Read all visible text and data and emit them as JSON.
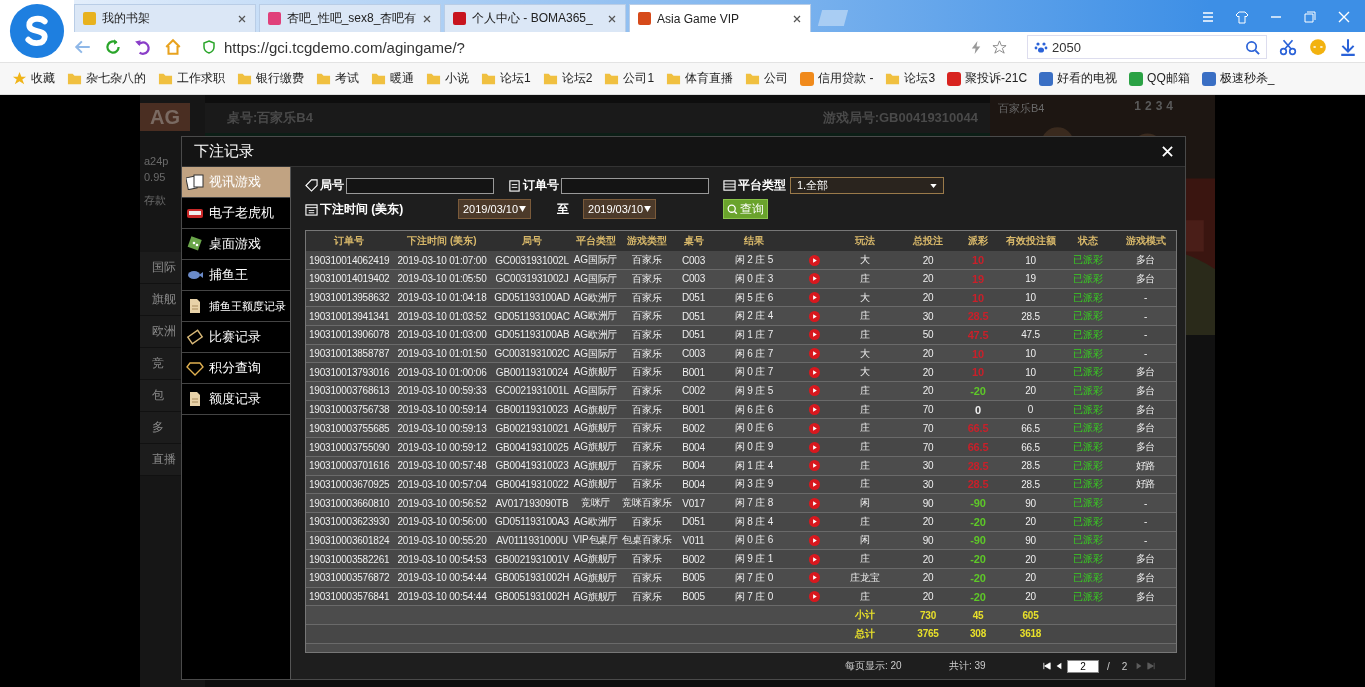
{
  "browser": {
    "tabs": [
      {
        "title": "我的书架",
        "kind": "book",
        "selected": false
      },
      {
        "title": "杏吧_性吧_sex8_杏吧有",
        "kind": "pink",
        "selected": false
      },
      {
        "title": "个人中心 - BOMA365_",
        "kind": "gear",
        "selected": false
      },
      {
        "title": "Asia Game VIP",
        "kind": "ag",
        "selected": true
      }
    ],
    "url": "https://gci.tcgdemo.com/agingame/?",
    "search_text": "2050",
    "bookmarks": [
      {
        "label": "收藏",
        "kind": "star"
      },
      {
        "label": "杂七杂八的",
        "kind": "folder"
      },
      {
        "label": "工作求职",
        "kind": "folder"
      },
      {
        "label": "银行缴费",
        "kind": "folder"
      },
      {
        "label": "考试",
        "kind": "folder"
      },
      {
        "label": "暖通",
        "kind": "folder"
      },
      {
        "label": "小说",
        "kind": "folder"
      },
      {
        "label": "论坛1",
        "kind": "folder"
      },
      {
        "label": "论坛2",
        "kind": "folder"
      },
      {
        "label": "公司1",
        "kind": "folder"
      },
      {
        "label": "体育直播",
        "kind": "folder"
      },
      {
        "label": "公司",
        "kind": "folder"
      },
      {
        "label": "信用贷款 -",
        "kind": "site",
        "color": "#f08a1c"
      },
      {
        "label": "论坛3",
        "kind": "folder"
      },
      {
        "label": "聚投诉-21C",
        "kind": "site",
        "color": "#d8231f"
      },
      {
        "label": "好看的电视",
        "kind": "site",
        "color": "#3a6fc4"
      },
      {
        "label": "QQ邮箱",
        "kind": "site",
        "color": "#2ba245"
      },
      {
        "label": "极速秒杀_",
        "kind": "site",
        "color": "#3a6fc4"
      }
    ]
  },
  "game": {
    "logo": "AG",
    "user": "a24p",
    "balance": "0.95",
    "deposit": "存款",
    "nav": [
      "国际",
      "旗舰",
      "欧洲",
      "竞",
      "包",
      "多",
      "直播"
    ],
    "table_title": "桌号:百家乐B4",
    "round": "游戏局号:GB00419310044",
    "video_title": "百家乐B4",
    "video_tabs": [
      "1",
      "2",
      "3",
      "4"
    ]
  },
  "modal": {
    "title": "下注记录",
    "sidebar": [
      {
        "label": "视讯游戏",
        "kind": "cards",
        "selected": true
      },
      {
        "label": "电子老虎机",
        "kind": "slot",
        "selected": false
      },
      {
        "label": "桌面游戏",
        "kind": "dice",
        "selected": false
      },
      {
        "label": "捕鱼王",
        "kind": "fish",
        "selected": false
      },
      {
        "label": "捕鱼王额度记录",
        "kind": "doc",
        "selected": false
      },
      {
        "label": "比赛记录",
        "kind": "ticket",
        "selected": false
      },
      {
        "label": "积分查询",
        "kind": "diamond",
        "selected": false
      },
      {
        "label": "额度记录",
        "kind": "doc",
        "selected": false
      }
    ],
    "filters": {
      "round_label": "局号",
      "order_label": "订单号",
      "platform_label": "平台类型",
      "platform_value": "1.全部",
      "time_label": "下注时间 (美东)",
      "date_from": "2019/03/10",
      "to_label": "至",
      "date_to": "2019/03/10",
      "query": "查询"
    },
    "table": {
      "columns": [
        "订单号",
        "下注时间 (美东)",
        "局号",
        "平台类型",
        "游戏类型",
        "桌号",
        "结果",
        "",
        "玩法",
        "总投注",
        "派彩",
        "有效投注额",
        "状态",
        "游戏模式"
      ],
      "rows": [
        {
          "id": "190310014062419",
          "time": "2019-03-10 01:07:00",
          "round": "GC0031931002L",
          "platform": "AG国际厅",
          "game": "百家乐",
          "table": "C003",
          "result": "闲 2 庄 5",
          "play": "大",
          "bet": "20",
          "payout": "10",
          "color": "#c8202a",
          "valid": "10",
          "status": "已派彩",
          "mode": "多台"
        },
        {
          "id": "190310014019402",
          "time": "2019-03-10 01:05:50",
          "round": "GC0031931002J",
          "platform": "AG国际厅",
          "game": "百家乐",
          "table": "C003",
          "result": "闲 0 庄 3",
          "play": "庄",
          "bet": "20",
          "payout": "19",
          "color": "#c8202a",
          "valid": "19",
          "status": "已派彩",
          "mode": "多台"
        },
        {
          "id": "190310013958632",
          "time": "2019-03-10 01:04:18",
          "round": "GD051193100AD",
          "platform": "AG欧洲厅",
          "game": "百家乐",
          "table": "D051",
          "result": "闲 5 庄 6",
          "play": "大",
          "bet": "20",
          "payout": "10",
          "color": "#c8202a",
          "valid": "10",
          "status": "已派彩",
          "mode": "-"
        },
        {
          "id": "190310013941341",
          "time": "2019-03-10 01:03:52",
          "round": "GD051193100AC",
          "platform": "AG欧洲厅",
          "game": "百家乐",
          "table": "D051",
          "result": "闲 2 庄 4",
          "play": "庄",
          "bet": "30",
          "payout": "28.5",
          "color": "#c8202a",
          "valid": "28.5",
          "status": "已派彩",
          "mode": "-"
        },
        {
          "id": "190310013906078",
          "time": "2019-03-10 01:03:00",
          "round": "GD051193100AB",
          "platform": "AG欧洲厅",
          "game": "百家乐",
          "table": "D051",
          "result": "闲 1 庄 7",
          "play": "庄",
          "bet": "50",
          "payout": "47.5",
          "color": "#c8202a",
          "valid": "47.5",
          "status": "已派彩",
          "mode": "-"
        },
        {
          "id": "190310013858787",
          "time": "2019-03-10 01:01:50",
          "round": "GC0031931002C",
          "platform": "AG国际厅",
          "game": "百家乐",
          "table": "C003",
          "result": "闲 6 庄 7",
          "play": "大",
          "bet": "20",
          "payout": "10",
          "color": "#c8202a",
          "valid": "10",
          "status": "已派彩",
          "mode": "-"
        },
        {
          "id": "190310013793016",
          "time": "2019-03-10 01:00:06",
          "round": "GB00119310024",
          "platform": "AG旗舰厅",
          "game": "百家乐",
          "table": "B001",
          "result": "闲 0 庄 7",
          "play": "大",
          "bet": "20",
          "payout": "10",
          "color": "#c8202a",
          "valid": "10",
          "status": "已派彩",
          "mode": "多台"
        },
        {
          "id": "190310003768613",
          "time": "2019-03-10 00:59:33",
          "round": "GC0021931001L",
          "platform": "AG国际厅",
          "game": "百家乐",
          "table": "C002",
          "result": "闲 9 庄 5",
          "play": "庄",
          "bet": "20",
          "payout": "-20",
          "color": "#5ec828",
          "valid": "20",
          "status": "已派彩",
          "mode": "多台"
        },
        {
          "id": "190310003756738",
          "time": "2019-03-10 00:59:14",
          "round": "GB00119310023",
          "platform": "AG旗舰厅",
          "game": "百家乐",
          "table": "B001",
          "result": "闲 6 庄 6",
          "play": "庄",
          "bet": "70",
          "payout": "0",
          "color": "#eeeeee",
          "valid": "0",
          "status": "已派彩",
          "mode": "多台"
        },
        {
          "id": "190310003755685",
          "time": "2019-03-10 00:59:13",
          "round": "GB00219310021",
          "platform": "AG旗舰厅",
          "game": "百家乐",
          "table": "B002",
          "result": "闲 0 庄 6",
          "play": "庄",
          "bet": "70",
          "payout": "66.5",
          "color": "#c8202a",
          "valid": "66.5",
          "status": "已派彩",
          "mode": "多台"
        },
        {
          "id": "190310003755090",
          "time": "2019-03-10 00:59:12",
          "round": "GB00419310025",
          "platform": "AG旗舰厅",
          "game": "百家乐",
          "table": "B004",
          "result": "闲 0 庄 9",
          "play": "庄",
          "bet": "70",
          "payout": "66.5",
          "color": "#c8202a",
          "valid": "66.5",
          "status": "已派彩",
          "mode": "多台"
        },
        {
          "id": "190310003701616",
          "time": "2019-03-10 00:57:48",
          "round": "GB00419310023",
          "platform": "AG旗舰厅",
          "game": "百家乐",
          "table": "B004",
          "result": "闲 1 庄 4",
          "play": "庄",
          "bet": "30",
          "payout": "28.5",
          "color": "#c8202a",
          "valid": "28.5",
          "status": "已派彩",
          "mode": "好路"
        },
        {
          "id": "190310003670925",
          "time": "2019-03-10 00:57:04",
          "round": "GB00419310022",
          "platform": "AG旗舰厅",
          "game": "百家乐",
          "table": "B004",
          "result": "闲 3 庄 9",
          "play": "庄",
          "bet": "30",
          "payout": "28.5",
          "color": "#c8202a",
          "valid": "28.5",
          "status": "已派彩",
          "mode": "好路"
        },
        {
          "id": "190310003660810",
          "time": "2019-03-10 00:56:52",
          "round": "AV017193090TB",
          "platform": "竞咪厅",
          "game": "竞咪百家乐",
          "table": "V017",
          "result": "闲 7 庄 8",
          "play": "闲",
          "bet": "90",
          "payout": "-90",
          "color": "#5ec828",
          "valid": "90",
          "status": "已派彩",
          "mode": "-"
        },
        {
          "id": "190310003623930",
          "time": "2019-03-10 00:56:00",
          "round": "GD051193100A3",
          "platform": "AG欧洲厅",
          "game": "百家乐",
          "table": "D051",
          "result": "闲 8 庄 4",
          "play": "庄",
          "bet": "20",
          "payout": "-20",
          "color": "#5ec828",
          "valid": "20",
          "status": "已派彩",
          "mode": "-"
        },
        {
          "id": "190310003601824",
          "time": "2019-03-10 00:55:20",
          "round": "AV0111931000U",
          "platform": "VIP包桌厅",
          "game": "包桌百家乐",
          "table": "V011",
          "result": "闲 0 庄 6",
          "play": "闲",
          "bet": "90",
          "payout": "-90",
          "color": "#5ec828",
          "valid": "90",
          "status": "已派彩",
          "mode": "-"
        },
        {
          "id": "190310003582261",
          "time": "2019-03-10 00:54:53",
          "round": "GB0021931001V",
          "platform": "AG旗舰厅",
          "game": "百家乐",
          "table": "B002",
          "result": "闲 9 庄 1",
          "play": "庄",
          "bet": "20",
          "payout": "-20",
          "color": "#5ec828",
          "valid": "20",
          "status": "已派彩",
          "mode": "多台"
        },
        {
          "id": "190310003576872",
          "time": "2019-03-10 00:54:44",
          "round": "GB0051931002H",
          "platform": "AG旗舰厅",
          "game": "百家乐",
          "table": "B005",
          "result": "闲 7 庄 0",
          "play": "庄龙宝",
          "bet": "20",
          "payout": "-20",
          "color": "#5ec828",
          "valid": "20",
          "status": "已派彩",
          "mode": "多台"
        },
        {
          "id": "190310003576841",
          "time": "2019-03-10 00:54:44",
          "round": "GB0051931002H",
          "platform": "AG旗舰厅",
          "game": "百家乐",
          "table": "B005",
          "result": "闲 7 庄 0",
          "play": "庄",
          "bet": "20",
          "payout": "-20",
          "color": "#5ec828",
          "valid": "20",
          "status": "已派彩",
          "mode": "多台"
        }
      ],
      "totals": [
        {
          "label": "小计",
          "bet": "730",
          "payout": "45",
          "valid": "605"
        },
        {
          "label": "总计",
          "bet": "3765",
          "payout": "308",
          "valid": "3618"
        }
      ]
    },
    "pager": {
      "per_page": "每页显示: 20",
      "total": "共计: 39",
      "page": "2",
      "sep": "/",
      "pages": "2"
    }
  }
}
